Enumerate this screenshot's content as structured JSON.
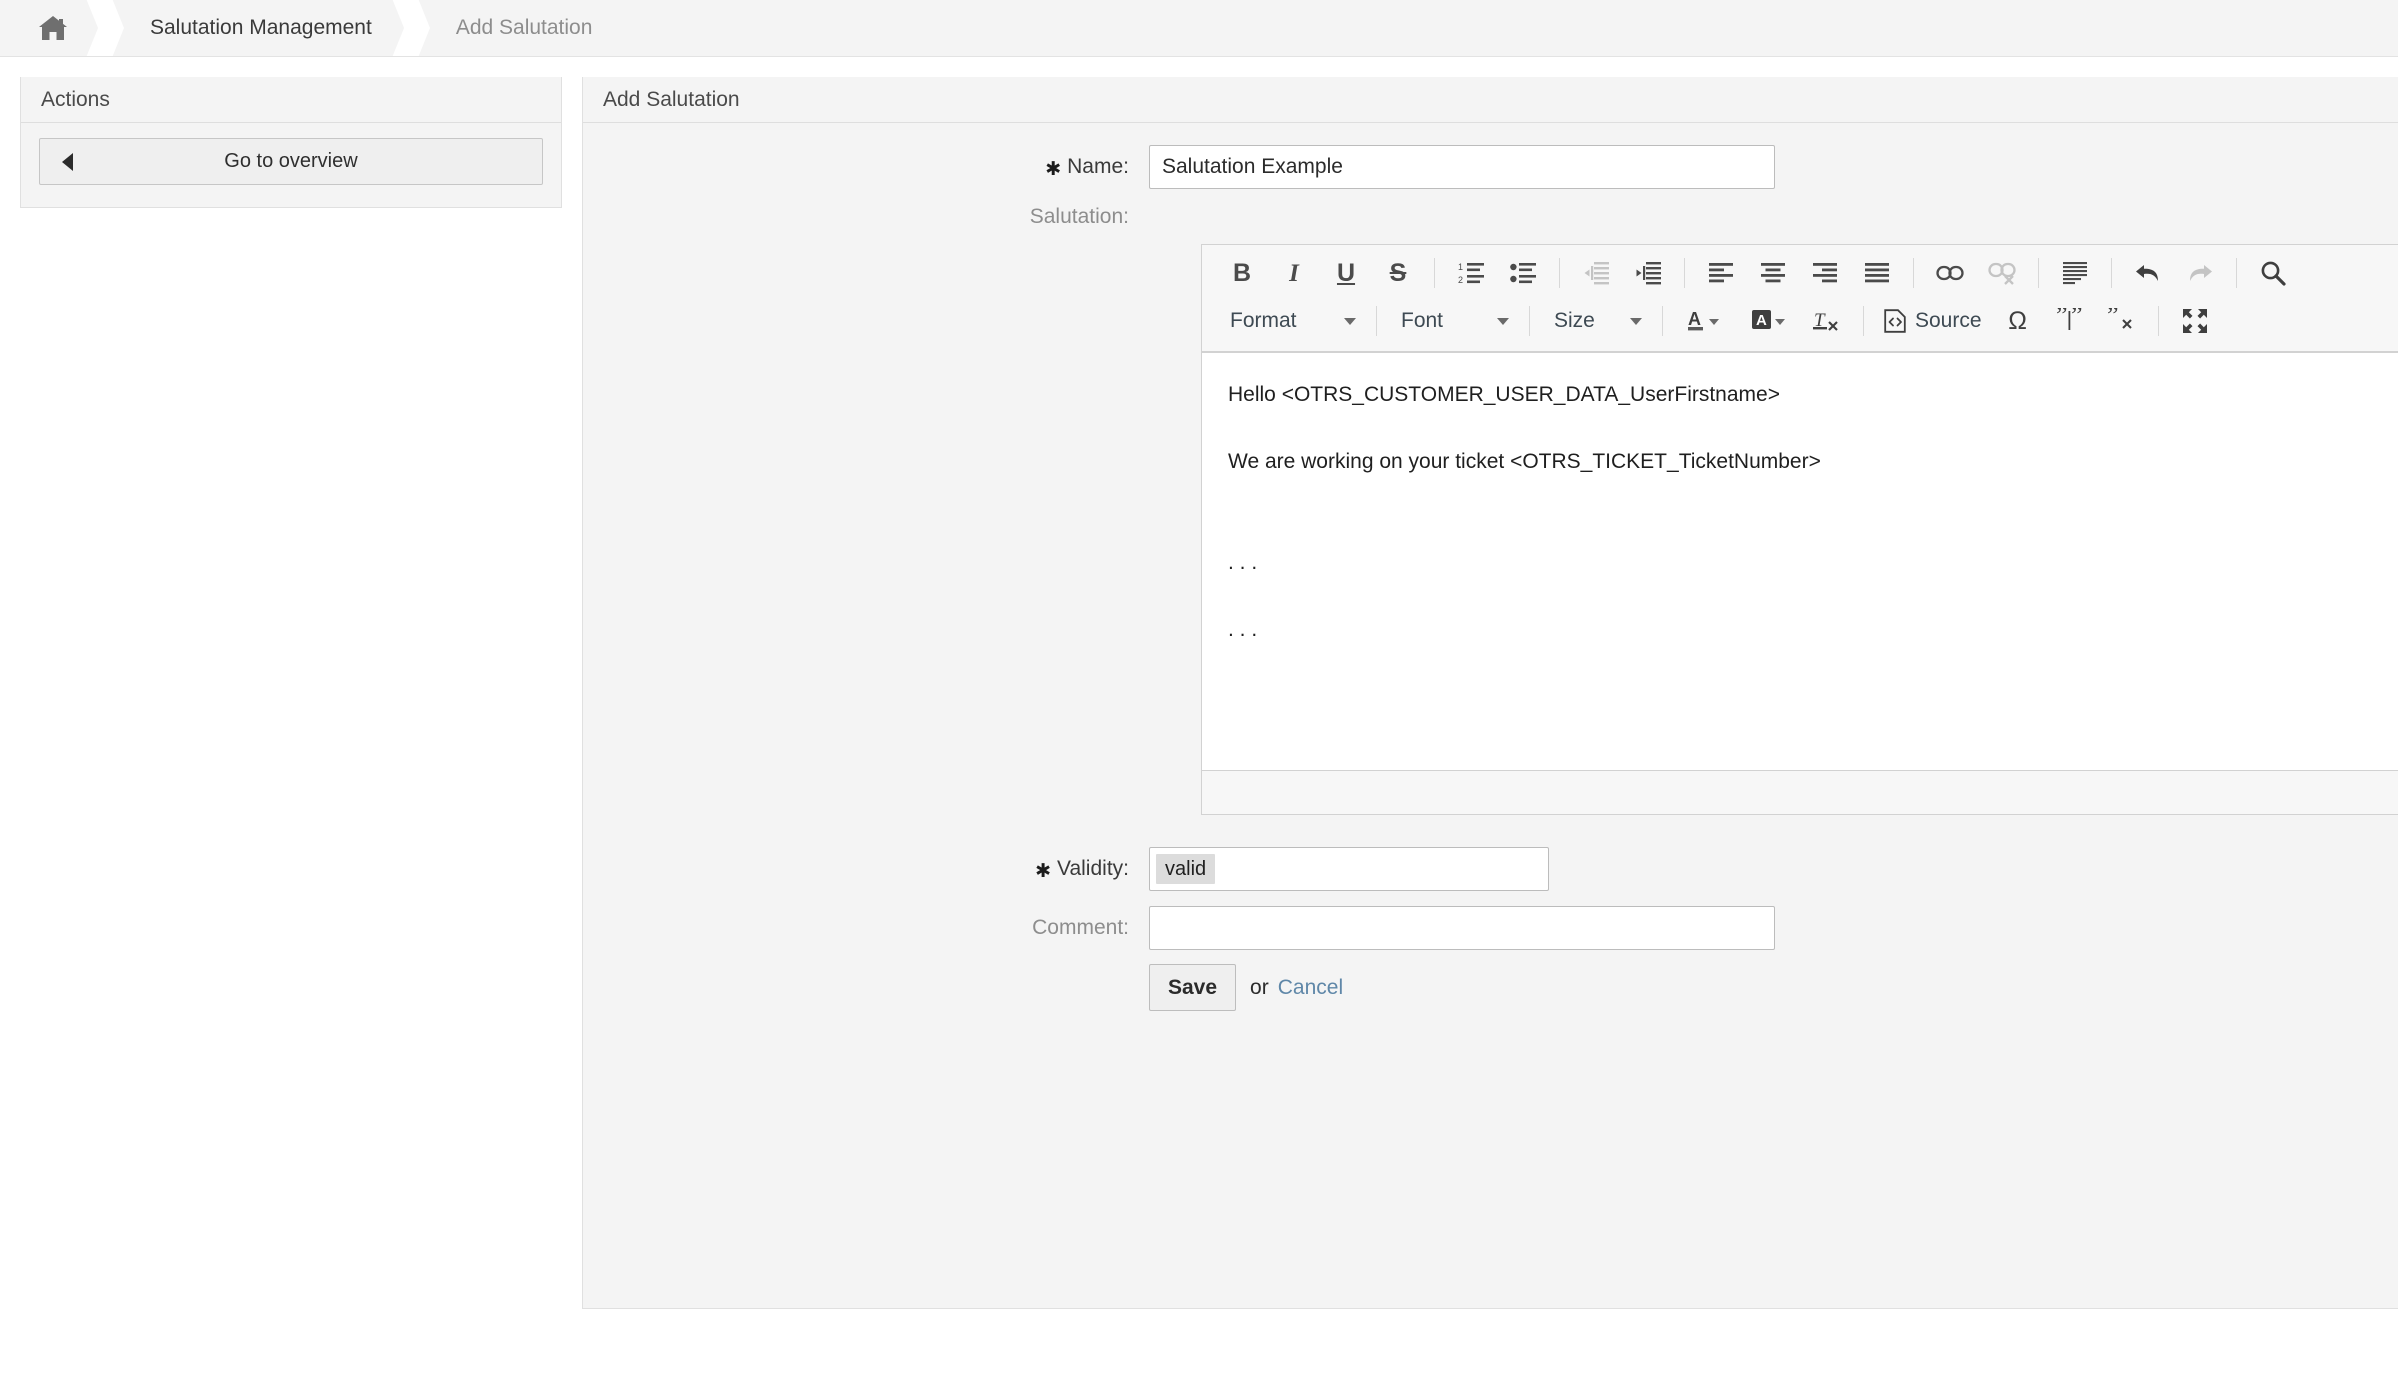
{
  "breadcrumb": {
    "home_icon": "home-icon",
    "items": [
      {
        "label": "Salutation Management",
        "current": false
      },
      {
        "label": "Add Salutation",
        "current": true
      }
    ]
  },
  "sidebar": {
    "title": "Actions",
    "go_to_overview_label": "Go to overview"
  },
  "main": {
    "title": "Add Salutation",
    "name_field": {
      "label": "Name:",
      "value": "Salutation Example",
      "required_marker": "✳",
      "placeholder": ""
    },
    "salutation_field": {
      "label": "Salutation:"
    },
    "validity_field": {
      "label": "Validity:",
      "value": "valid",
      "required_marker": "✳"
    },
    "comment_field": {
      "label": "Comment:",
      "value": "",
      "placeholder": ""
    },
    "submit": {
      "save_label": "Save",
      "or_label": "or",
      "cancel_label": "Cancel"
    }
  },
  "editor": {
    "toolbar_row1": [
      {
        "name": "bold-icon",
        "label": "B",
        "kind": "text-bold",
        "disabled": false
      },
      {
        "name": "italic-icon",
        "label": "I",
        "kind": "text-italic",
        "disabled": false
      },
      {
        "name": "underline-icon",
        "label": "U",
        "kind": "text-underline",
        "disabled": false
      },
      {
        "name": "strikethrough-icon",
        "label": "S",
        "kind": "text-strike",
        "disabled": false
      },
      {
        "name": "separator",
        "kind": "sep"
      },
      {
        "name": "numbered-list-icon",
        "kind": "svg-numlist",
        "disabled": false
      },
      {
        "name": "bulleted-list-icon",
        "kind": "svg-bullist",
        "disabled": false
      },
      {
        "name": "separator",
        "kind": "sep"
      },
      {
        "name": "decrease-indent-icon",
        "kind": "svg-outdent",
        "disabled": true
      },
      {
        "name": "increase-indent-icon",
        "kind": "svg-indent",
        "disabled": false
      },
      {
        "name": "separator",
        "kind": "sep"
      },
      {
        "name": "align-left-icon",
        "kind": "svg-alignleft",
        "disabled": false
      },
      {
        "name": "align-center-icon",
        "kind": "svg-aligncenter",
        "disabled": false
      },
      {
        "name": "align-right-icon",
        "kind": "svg-alignright",
        "disabled": false
      },
      {
        "name": "align-justify-icon",
        "kind": "svg-alignjustify",
        "disabled": false
      },
      {
        "name": "separator",
        "kind": "sep"
      },
      {
        "name": "link-icon",
        "kind": "svg-link",
        "disabled": false
      },
      {
        "name": "unlink-icon",
        "kind": "svg-unlink",
        "disabled": true
      },
      {
        "name": "separator",
        "kind": "sep"
      },
      {
        "name": "horizontal-rule-icon",
        "kind": "svg-hrule",
        "disabled": false
      },
      {
        "name": "separator",
        "kind": "sep"
      },
      {
        "name": "undo-icon",
        "kind": "svg-undo",
        "disabled": false
      },
      {
        "name": "redo-icon",
        "kind": "svg-redo",
        "disabled": true
      },
      {
        "name": "separator",
        "kind": "sep"
      },
      {
        "name": "find-icon",
        "kind": "svg-find",
        "disabled": false
      }
    ],
    "combos": {
      "format_label": "Format",
      "font_label": "Font",
      "size_label": "Size"
    },
    "source_label": "Source",
    "content": [
      {
        "text": "Hello <OTRS_CUSTOMER_USER_DATA_UserFirstname>"
      },
      {
        "text": ""
      },
      {
        "text": "We are working on your ticket <OTRS_TICKET_TicketNumber>"
      },
      {
        "text": ""
      },
      {
        "text": ""
      },
      {
        "text": ". . ."
      },
      {
        "text": ""
      },
      {
        "text": ". . ."
      }
    ]
  },
  "colors": {
    "page_background": "#ffffff",
    "panel_background": "#f4f4f4",
    "panel_border": "#e0e0e0",
    "breadcrumb_background": "#f4f4f4",
    "text_primary": "#3a3a3a",
    "text_muted": "#8d8d8d",
    "link": "#5f87a8",
    "editor_background": "#ffffff",
    "toolbar_background": "#f7f7f7",
    "chip_background": "#dcdcdc"
  }
}
